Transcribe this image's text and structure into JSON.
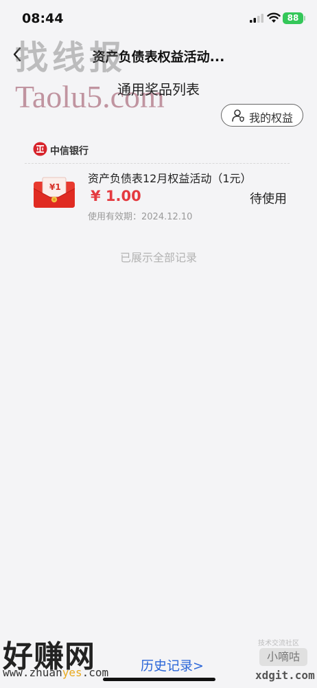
{
  "status_bar": {
    "time": "08:44",
    "battery": "88"
  },
  "nav": {
    "title": "资产负债表权益活动..."
  },
  "page": {
    "subtitle": "通用奖品列表",
    "rights_button": "我的权益"
  },
  "bank": {
    "name": "中信银行"
  },
  "prize": {
    "envelope_label": "¥1",
    "name": "资产负债表12月权益活动（1元）",
    "price": "¥ 1.00",
    "status": "待使用",
    "expiry": "使用有效期：2024.12.10"
  },
  "footer": {
    "all_shown": "已展示全部记录",
    "history_link": "历史记录>"
  },
  "watermarks": {
    "top_text": "找线报",
    "top_site": "Taolu5.com",
    "bottom_left_text": "好赚网",
    "bottom_left_site_a": "www.zhuan",
    "bottom_left_site_b": "yes",
    "bottom_left_site_c": ".com",
    "bottom_right_small": "技术交流社区",
    "bottom_right_badge": "小嘀咕",
    "bottom_right_site": "xdgit.com"
  },
  "colors": {
    "accent_red": "#e43a3f",
    "link_blue": "#2b66d8",
    "battery_green": "#34c759"
  }
}
